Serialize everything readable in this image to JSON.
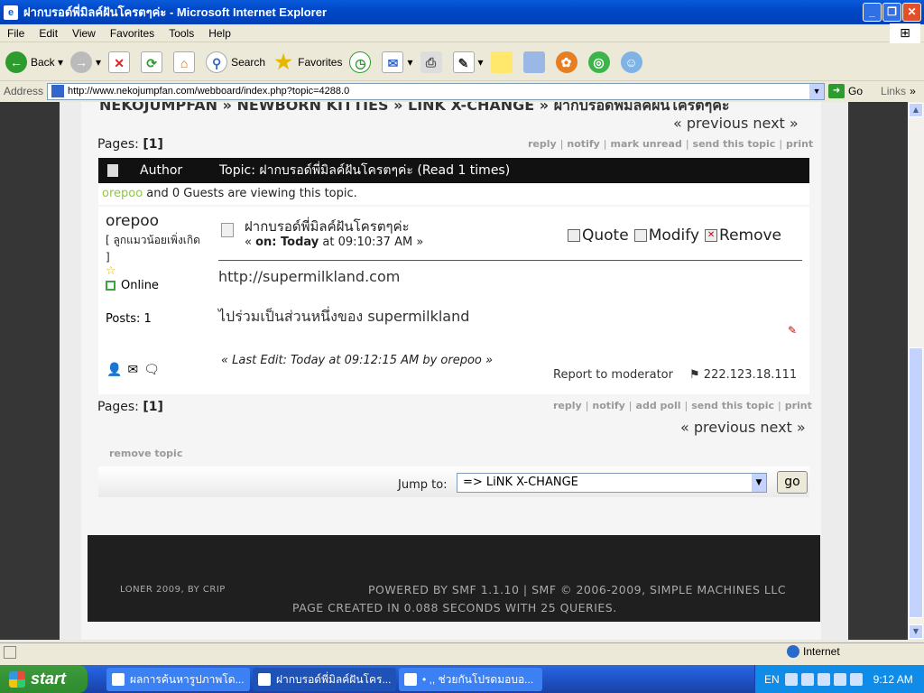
{
  "window": {
    "title": "ฝากบรอด์พี่มิลค์ฝันโครตๆค่ะ - Microsoft Internet Explorer"
  },
  "menu": [
    "File",
    "Edit",
    "View",
    "Favorites",
    "Tools",
    "Help"
  ],
  "toolbar": {
    "back": "Back",
    "search": "Search",
    "favorites": "Favorites"
  },
  "address": {
    "label": "Address",
    "url": "http://www.nekojumpfan.com/webboard/index.php?topic=4288.0",
    "go": "Go",
    "links": "Links"
  },
  "forum": {
    "breadcrumb": "NEKOJUMPFAN » NEWBORN KITTIES » LINK X-CHANGE » ฝากบรอด์พี่มิลค์ฝันโครตๆค่ะ",
    "prev_next": "« previous next »",
    "pages_label": "Pages:",
    "pages_value": "[1]",
    "top_actions": [
      "reply",
      "notify",
      "mark unread",
      "send this topic",
      "print"
    ],
    "bottom_actions": [
      "reply",
      "notify",
      "add poll",
      "send this topic",
      "print"
    ],
    "author_header": "Author",
    "topic_header": "Topic: ฝากบรอด์พี่มิลค์ฝันโครตๆค่ะ  (Read 1 times)",
    "viewing_user": "orepoo",
    "viewing_text": " and 0 Guests are viewing this topic.",
    "remove_topic": "remove topic",
    "jump_label": "Jump to:",
    "jump_value": "=> LiNK X-CHANGE",
    "go_button": "go"
  },
  "post": {
    "poster_name": "orepoo",
    "poster_title": "[ ลูกแมวน้อยเพิ่งเกิด ]",
    "status": "Online",
    "posts": "Posts: 1",
    "subject": "ฝากบรอด์พี่มิลค์ฝันโครตๆค่ะ",
    "date_prefix": "« ",
    "date_on": "on: Today",
    "date_time": " at 09:10:37 AM »",
    "quote": "Quote",
    "modify": "Modify",
    "remove": "Remove",
    "body_line1": "http://supermilkland.com",
    "body_line2": "ไปร่วมเป็นส่วนหนึ่งของ supermilkland",
    "last_edit": "« Last Edit: Today at 09:12:15 AM by orepoo »",
    "report": "Report to moderator",
    "ip": "222.123.18.111"
  },
  "footer": {
    "theme": "LONER 2009, BY CRIP",
    "powered": "POWERED BY SMF 1.1.10 | SMF © 2006-2009, SIMPLE MACHINES LLC",
    "created": "PAGE CREATED IN 0.088 SECONDS WITH 25 QUERIES."
  },
  "statusbar": {
    "zone": "Internet"
  },
  "taskbar": {
    "start": "start",
    "tasks": [
      "ผลการค้นหารูปภาพโด...",
      "ฝากบรอด์พี่มิลค์ฝันโคร...",
      "• ,, ช่วยกันโปรดมอบอ..."
    ],
    "lang": "EN",
    "clock": "9:12 AM"
  }
}
